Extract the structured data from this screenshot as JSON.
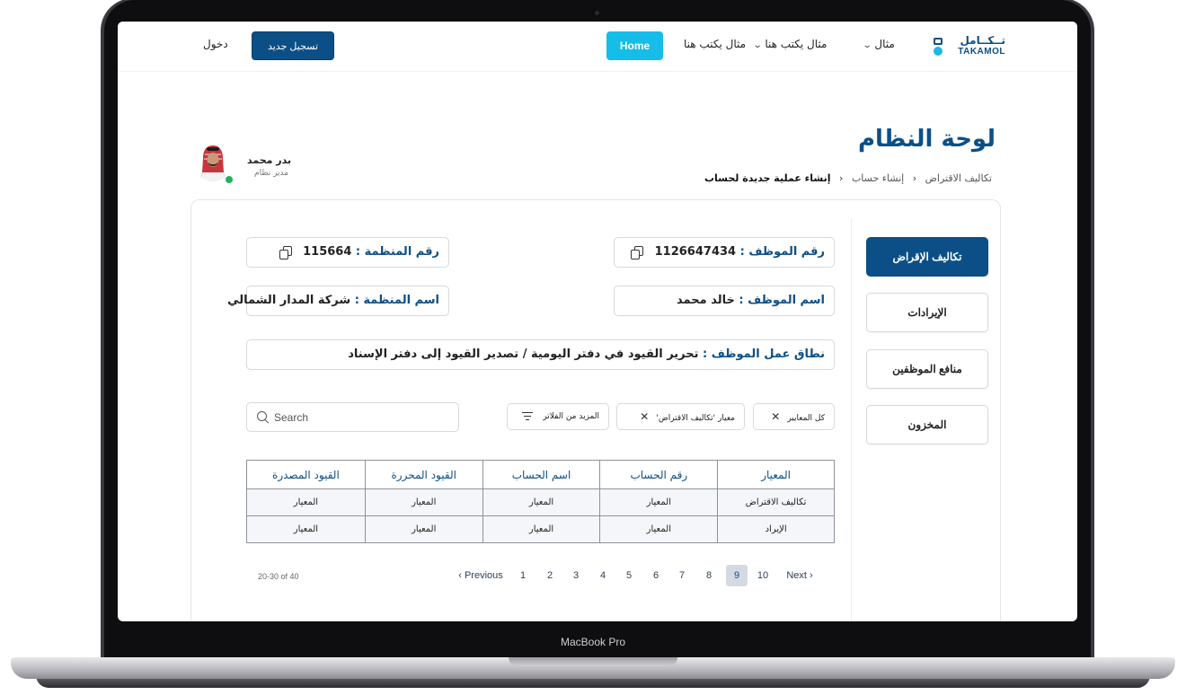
{
  "device": {
    "label": "MacBook Pro"
  },
  "nav": {
    "logo_ar": "تــكــامل",
    "logo_en": "TAKAMOL",
    "links": [
      {
        "label": "مثال"
      },
      {
        "label": "مثال يكتب هنا"
      },
      {
        "label": "مثال يكتب هنا"
      }
    ],
    "home_label": "Home",
    "register_label": "تسجيل جديد",
    "login_label": "دخول"
  },
  "header": {
    "title": "لوحة النظام",
    "breadcrumb": [
      "تكاليف الاقتراض",
      "إنشاء حساب",
      "إنشاء عملية جديدة لحساب"
    ]
  },
  "user": {
    "name": "بدر محمد",
    "role": "مدير نظام",
    "status_color": "#22b25a"
  },
  "sidebar": {
    "items": [
      {
        "label": "تكاليف الإقراض",
        "active": true
      },
      {
        "label": "الإيرادات",
        "active": false
      },
      {
        "label": "منافع الموظفين",
        "active": false
      },
      {
        "label": "المخزون",
        "active": false
      }
    ]
  },
  "info": {
    "employee_number_key": "رقم الموظف :",
    "employee_number": "1126647434",
    "org_number_key": "رقم المنظمة :",
    "org_number": "115664",
    "employee_name_key": "اسم الموظف :",
    "employee_name": "خالد محمد",
    "org_name_key": "اسم المنظمة :",
    "org_name": "شركة المدار الشمالي",
    "scope_key": "نطاق عمل الموظف :",
    "scope": "تحرير القيود في دفتر اليومية / تصدير القيود إلى دفتر الإسناد"
  },
  "filters": {
    "chips": [
      "كل المعايير",
      "معيار 'تكاليف الاقتراض'"
    ],
    "more_label": "المزيد من الفلاتر",
    "search_placeholder": "Search"
  },
  "table": {
    "columns": [
      "المعيار",
      "رقم الحساب",
      "اسم الحساب",
      "القيود المحررة",
      "القيود المصدرة"
    ],
    "rows": [
      [
        "تكاليف الاقتراض",
        "المعيار",
        "المعيار",
        "المعيار",
        "المعيار"
      ],
      [
        "الإيراد",
        "المعيار",
        "المعيار",
        "المعيار",
        "المعيار"
      ]
    ]
  },
  "pagination": {
    "range": "20-30 of 40",
    "previous": "Previous",
    "next": "Next",
    "pages": [
      "1",
      "2",
      "3",
      "4",
      "5",
      "6",
      "7",
      "8",
      "9",
      "10"
    ],
    "current": "9"
  },
  "colors": {
    "primary": "#0b4f86",
    "accent": "#16bde8"
  }
}
